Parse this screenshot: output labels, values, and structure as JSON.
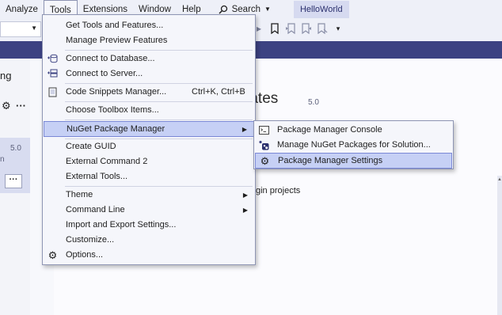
{
  "menubar": {
    "items": [
      "Analyze",
      "Tools",
      "Extensions",
      "Window",
      "Help"
    ],
    "search_label": "Search",
    "solution_name": "HelloWorld"
  },
  "background": {
    "left_panel_text": "ng",
    "left_version": "5.0",
    "left_letter": "n",
    "title_partial": "nplates",
    "title_version": "5.0",
    "plugin_text": "gin projects"
  },
  "tools_menu": {
    "items": [
      {
        "label": "Get Tools and Features...",
        "icon": "",
        "shortcut": "",
        "submenu": false
      },
      {
        "label": "Manage Preview Features",
        "icon": "",
        "shortcut": "",
        "submenu": false
      },
      {
        "label": "Connect to Database...",
        "icon": "database-connect-icon",
        "shortcut": "",
        "submenu": false
      },
      {
        "label": "Connect to Server...",
        "icon": "server-connect-icon",
        "shortcut": "",
        "submenu": false
      },
      {
        "label": "Code Snippets Manager...",
        "icon": "snippet-icon",
        "shortcut": "Ctrl+K, Ctrl+B",
        "submenu": false
      },
      {
        "label": "Choose Toolbox Items...",
        "icon": "",
        "shortcut": "",
        "submenu": false
      },
      {
        "label": "NuGet Package Manager",
        "icon": "",
        "shortcut": "",
        "submenu": true
      },
      {
        "label": "Create GUID",
        "icon": "",
        "shortcut": "",
        "submenu": false
      },
      {
        "label": "External Command 2",
        "icon": "",
        "shortcut": "",
        "submenu": false
      },
      {
        "label": "External Tools...",
        "icon": "",
        "shortcut": "",
        "submenu": false
      },
      {
        "label": "Theme",
        "icon": "",
        "shortcut": "",
        "submenu": true
      },
      {
        "label": "Command Line",
        "icon": "",
        "shortcut": "",
        "submenu": true
      },
      {
        "label": "Import and Export Settings...",
        "icon": "",
        "shortcut": "",
        "submenu": false
      },
      {
        "label": "Customize...",
        "icon": "",
        "shortcut": "",
        "submenu": false
      },
      {
        "label": "Options...",
        "icon": "gear-icon",
        "shortcut": "",
        "submenu": false
      }
    ]
  },
  "nuget_submenu": {
    "items": [
      {
        "label": "Package Manager Console",
        "icon": "console-icon"
      },
      {
        "label": "Manage NuGet Packages for Solution...",
        "icon": "nuget-icon"
      },
      {
        "label": "Package Manager Settings",
        "icon": "gear-icon"
      }
    ]
  },
  "colors": {
    "accent_bar": "#3c4282",
    "highlight": "#c6d0f5",
    "menu_bg": "#f5f6fb"
  }
}
